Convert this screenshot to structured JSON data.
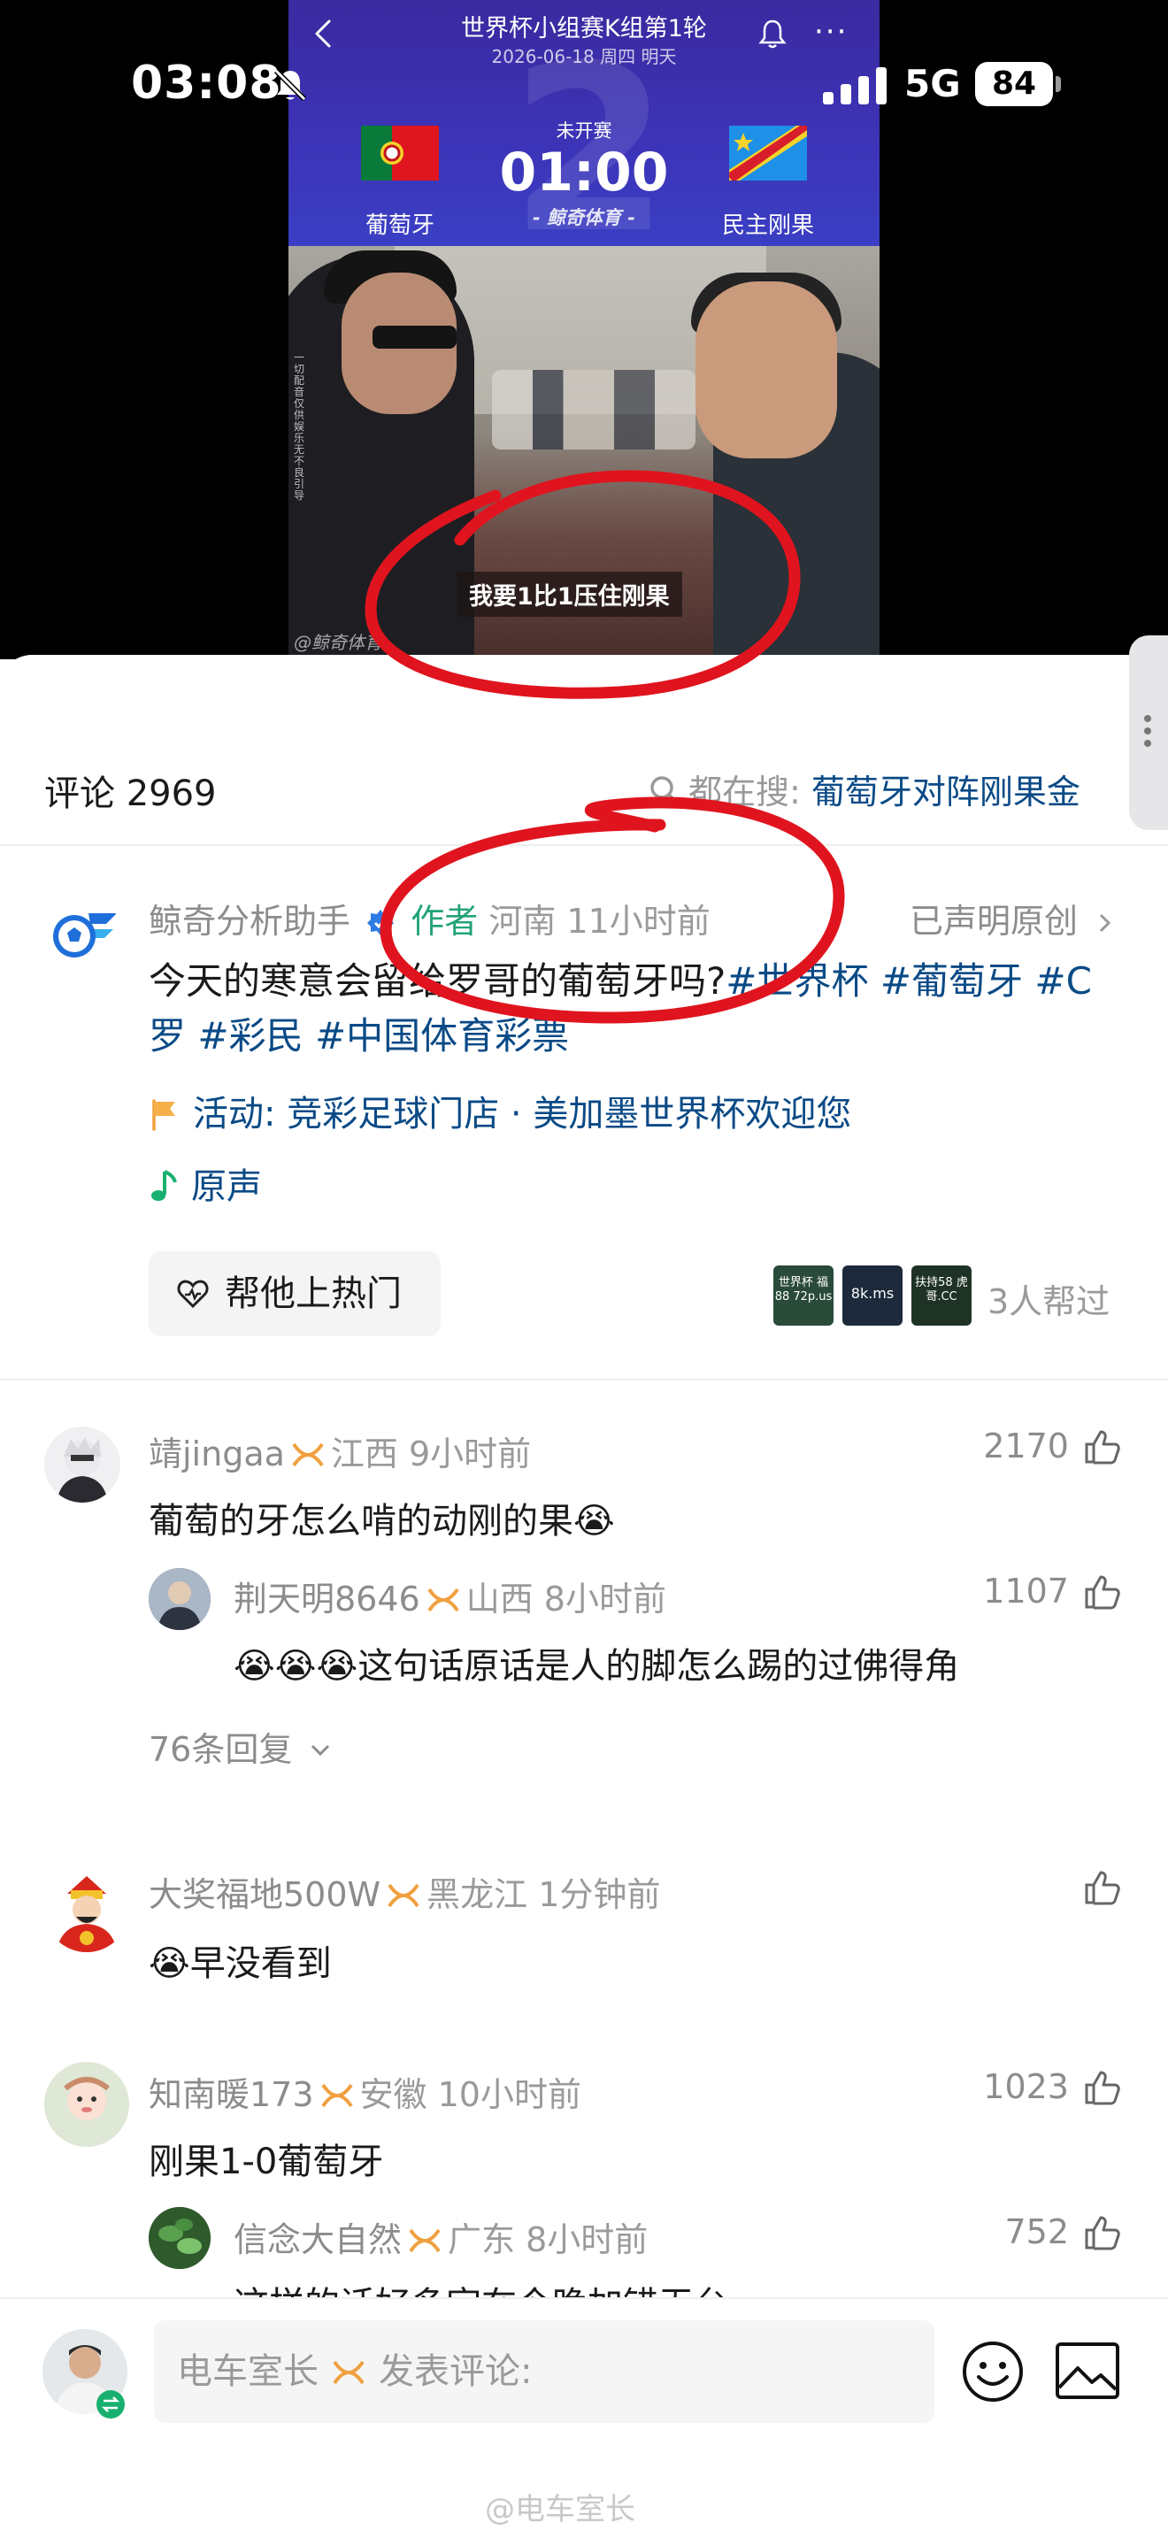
{
  "status_bar": {
    "time": "03:08",
    "network": "5G",
    "battery": "84"
  },
  "match": {
    "title": "世界杯小组赛K组第1轮",
    "date": "2026-06-18 周四 明天",
    "status": "未开赛",
    "kickoff": "01:00",
    "source": "- 鲸奇体育 -",
    "home_team": "葡萄牙",
    "away_team": "民主刚果",
    "bg_digit": "2"
  },
  "video": {
    "subtitle": "我要1比1压住刚果",
    "side_text": "一切配音仅供娱乐无不良引导",
    "watermark": "@鲸奇体育"
  },
  "comments_header": {
    "label": "评论 2969",
    "search_prefix": "都在搜:",
    "search_term": "葡萄牙对阵刚果金"
  },
  "post": {
    "author": "鲸奇分析助手",
    "author_tag": "作者",
    "meta": "河南 11小时前",
    "original": "已声明原创",
    "text_plain": "今天的寒意会留给罗哥的葡萄牙吗?",
    "tags": [
      "#世界杯",
      "#葡萄牙",
      "#C罗",
      "#彩民",
      "#中国体育彩票"
    ],
    "activity": "活动: 竞彩足球门店 · 美加墨世界杯欢迎您",
    "sound": "原声",
    "hot_button": "帮他上热门",
    "helpers": [
      "世界杯 福88 72p.us",
      "8k.ms",
      "扶持58 虎哥.CC"
    ],
    "helpers_count": "3人帮过"
  },
  "comments": [
    {
      "name": "靖jingaa",
      "meta": "江西 9小时前",
      "text": "葡萄的牙怎么啃的动刚的果😭",
      "likes": "2170",
      "reply": {
        "name": "荆天明8646",
        "meta": "山西 8小时前",
        "text": "😭😭😭这句话原话是人的脚怎么踢的过佛得角",
        "likes": "1107"
      },
      "replies_label": "76条回复"
    },
    {
      "name": "大奖福地500W",
      "meta": "黑龙江 1分钟前",
      "text": "😭早没看到",
      "likes": ""
    },
    {
      "name": "知南暖173",
      "meta": "安徽 10小时前",
      "text": "刚果1-0葡萄牙",
      "likes": "1023",
      "reply": {
        "name": "信念大自然",
        "meta": "广东 8小时前",
        "text": "这样的话好多宗在今晚加错无台",
        "likes": "752"
      }
    }
  ],
  "input_bar": {
    "placeholder_user": "电车室长",
    "placeholder_text": "发表评论:"
  },
  "watermark": "@电车室长",
  "colors": {
    "accent_blue": "#0a4a86",
    "author_green": "#22a37a",
    "annotation_red": "#e0141e",
    "vip_orange": "#f0a040"
  }
}
